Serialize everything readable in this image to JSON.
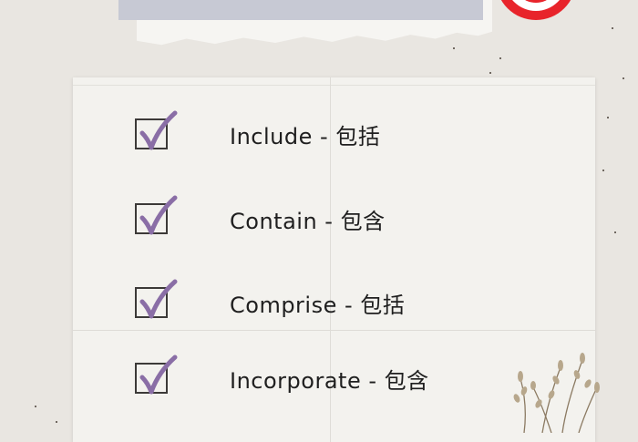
{
  "items": [
    {
      "label": "Include - 包括",
      "checked": true
    },
    {
      "label": "Contain - 包含",
      "checked": true
    },
    {
      "label": "Comprise - 包括",
      "checked": true
    },
    {
      "label": "Incorporate - 包含",
      "checked": true
    }
  ],
  "colors": {
    "background": "#e9e6e1",
    "card": "#f3f2ee",
    "checkmark": "#8a6ea6",
    "checkbox_border": "#3c3a38",
    "tape": "#c7c9d4",
    "target_red": "#e8242b"
  }
}
